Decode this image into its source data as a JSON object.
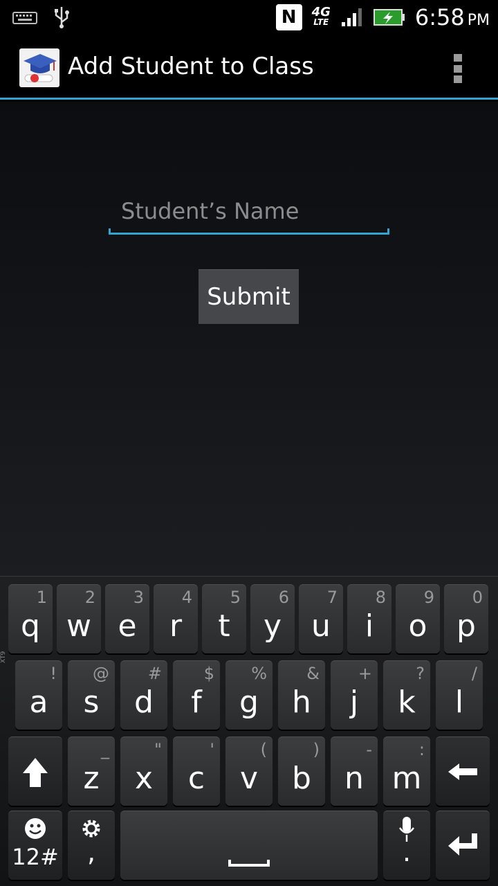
{
  "status_bar": {
    "time": "6:58",
    "ampm": "PM",
    "network": "4G",
    "network_sub": "LTE",
    "nfc_label": "N",
    "icons": [
      "keyboard-icon",
      "usb-icon",
      "nfc-icon",
      "lte-icon",
      "signal-icon",
      "battery-charging-icon"
    ]
  },
  "action_bar": {
    "title": "Add Student to Class",
    "app_icon": "graduation-cap-icon",
    "overflow_icon": "overflow-menu-icon"
  },
  "form": {
    "name_placeholder": "Student’s Name",
    "name_value": "",
    "submit_label": "Submit"
  },
  "keyboard": {
    "side_label": "XT9",
    "row1": [
      {
        "main": "q",
        "sub": "1"
      },
      {
        "main": "w",
        "sub": "2"
      },
      {
        "main": "e",
        "sub": "3"
      },
      {
        "main": "r",
        "sub": "4"
      },
      {
        "main": "t",
        "sub": "5"
      },
      {
        "main": "y",
        "sub": "6"
      },
      {
        "main": "u",
        "sub": "7"
      },
      {
        "main": "i",
        "sub": "8"
      },
      {
        "main": "o",
        "sub": "9"
      },
      {
        "main": "p",
        "sub": "0"
      }
    ],
    "row2": [
      {
        "main": "a",
        "sub": "!"
      },
      {
        "main": "s",
        "sub": "@"
      },
      {
        "main": "d",
        "sub": "#"
      },
      {
        "main": "f",
        "sub": "$"
      },
      {
        "main": "g",
        "sub": "%"
      },
      {
        "main": "h",
        "sub": "&"
      },
      {
        "main": "j",
        "sub": "+"
      },
      {
        "main": "k",
        "sub": "?"
      },
      {
        "main": "l",
        "sub": "/"
      }
    ],
    "row3": [
      {
        "main": "z",
        "sub": "_"
      },
      {
        "main": "x",
        "sub": "\""
      },
      {
        "main": "c",
        "sub": "'"
      },
      {
        "main": "v",
        "sub": "("
      },
      {
        "main": "b",
        "sub": ")"
      },
      {
        "main": "n",
        "sub": "-"
      },
      {
        "main": "m",
        "sub": ":"
      }
    ],
    "symbols_label": "12#",
    "comma_label": ",",
    "period_label": ".",
    "accent_color": "#33a3d0"
  }
}
